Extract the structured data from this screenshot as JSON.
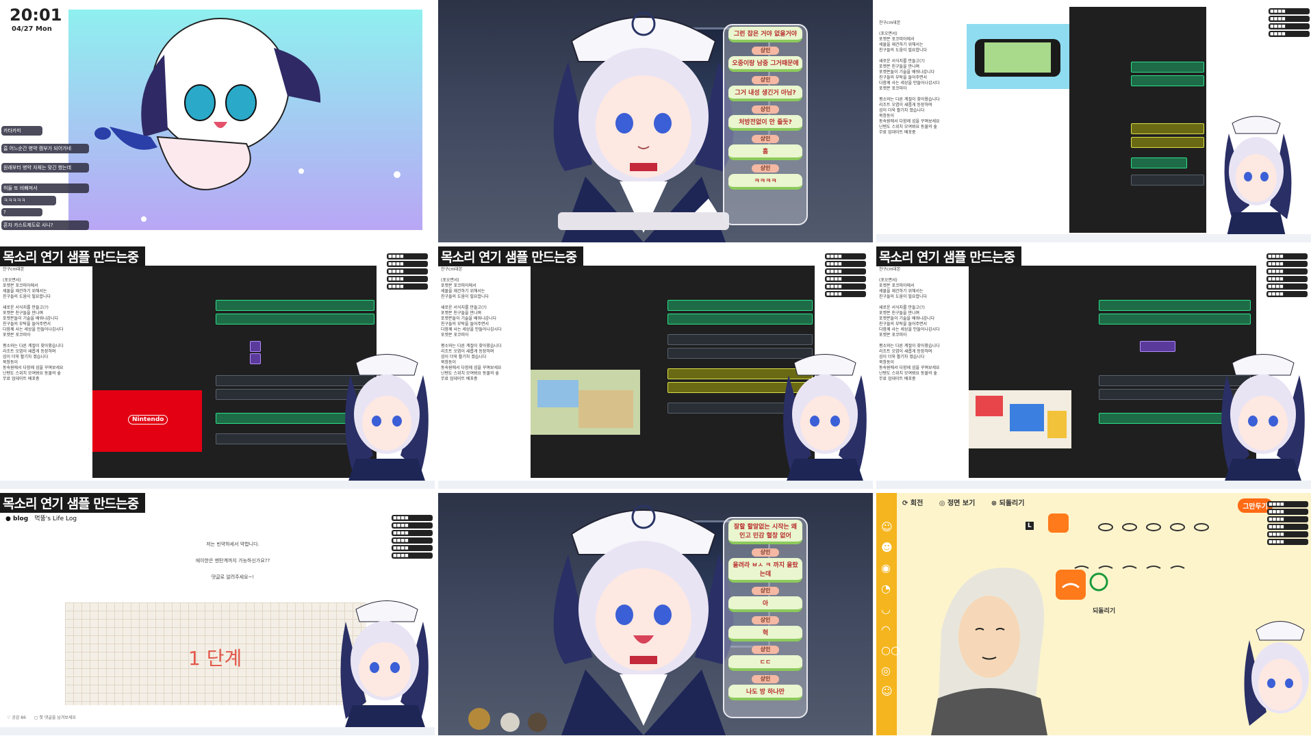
{
  "overlay": {
    "title": "목소리 연기 샘플 만드는중",
    "clock_time": "20:01",
    "clock_date": "04/27 Mon"
  },
  "tile1": {
    "chat": [
      "카타카미",
      "흠 어느순간 병약 캠부가 되어가네",
      "원래부터 병약 자체는 맞긴 했는데",
      "허들 또 비빠져서",
      "ㅋㅋㅋㅋㅋ",
      "?",
      "혼자 카스트제도로 사니?"
    ]
  },
  "tile2": {
    "bubbles": [
      "그런 잡은 거야 없을거야",
      "오중이랑 남중 그거때문에",
      "그거 내성 생긴거 아님?",
      "처방전없이 안 줄듯?",
      "흠",
      "ㅋㅋㅋㅋ"
    ],
    "label": "상인"
  },
  "doc_text": "찬구cm대본\n\n(포오면서)\n포켓몬 포코피아에서\n세물을 재건하기 위해서는\n친구들의 도움이     필요합니다\n\n새로운 서식지를 만들고(?)\n포켓몬 친구들을 만나며\n포켓몬들이 기술을     배워나갑니다\n친구들의 부탁을 들어주면서\n다함께 사는 세상을    만들어나갑시다\n포켓몬 포코피아\n\n평소와는 다른 계절이 찾아왔습니다\n리조트 오염이 새롭게 등장하며\n섬이 더욱 활기차 졌습니다\n북창동이\n동숙원에서 다함께 섬을 꾸며보세요\n닌텐도 스위치 모여봐요 동물의 숲\n무료 업데이트 배포중",
  "tile4": {
    "nintendo_label": "Nintendo"
  },
  "tile7": {
    "blog_title": "blog",
    "blog_owner": "먹뚱's Life Log",
    "lines": [
      "저는 빈약하세서 약합니다.",
      "에이한은 멘탄계까지 가능하신가요??",
      "댓글로 알려주세요~!"
    ],
    "handwriting": "1 단계",
    "footer_like": "공감 86",
    "footer_comment": "첫 댓글을 남겨보세요"
  },
  "tile8": {
    "bubbles": [
      "잘할 할말없는 시작는 왜인고 민감 혈창 없어",
      "올려라 ㅂㅅ ㅋ 까지 올랐는데",
      "아",
      "혁",
      "ㄷㄷ",
      "나도 방 하나만"
    ],
    "label": "상인"
  },
  "tile9": {
    "toolbar": [
      "회전",
      "정면 보기",
      "되돌리기"
    ],
    "quit_button": "그만두기",
    "undo_label": "되돌리기",
    "l_key": "L"
  }
}
